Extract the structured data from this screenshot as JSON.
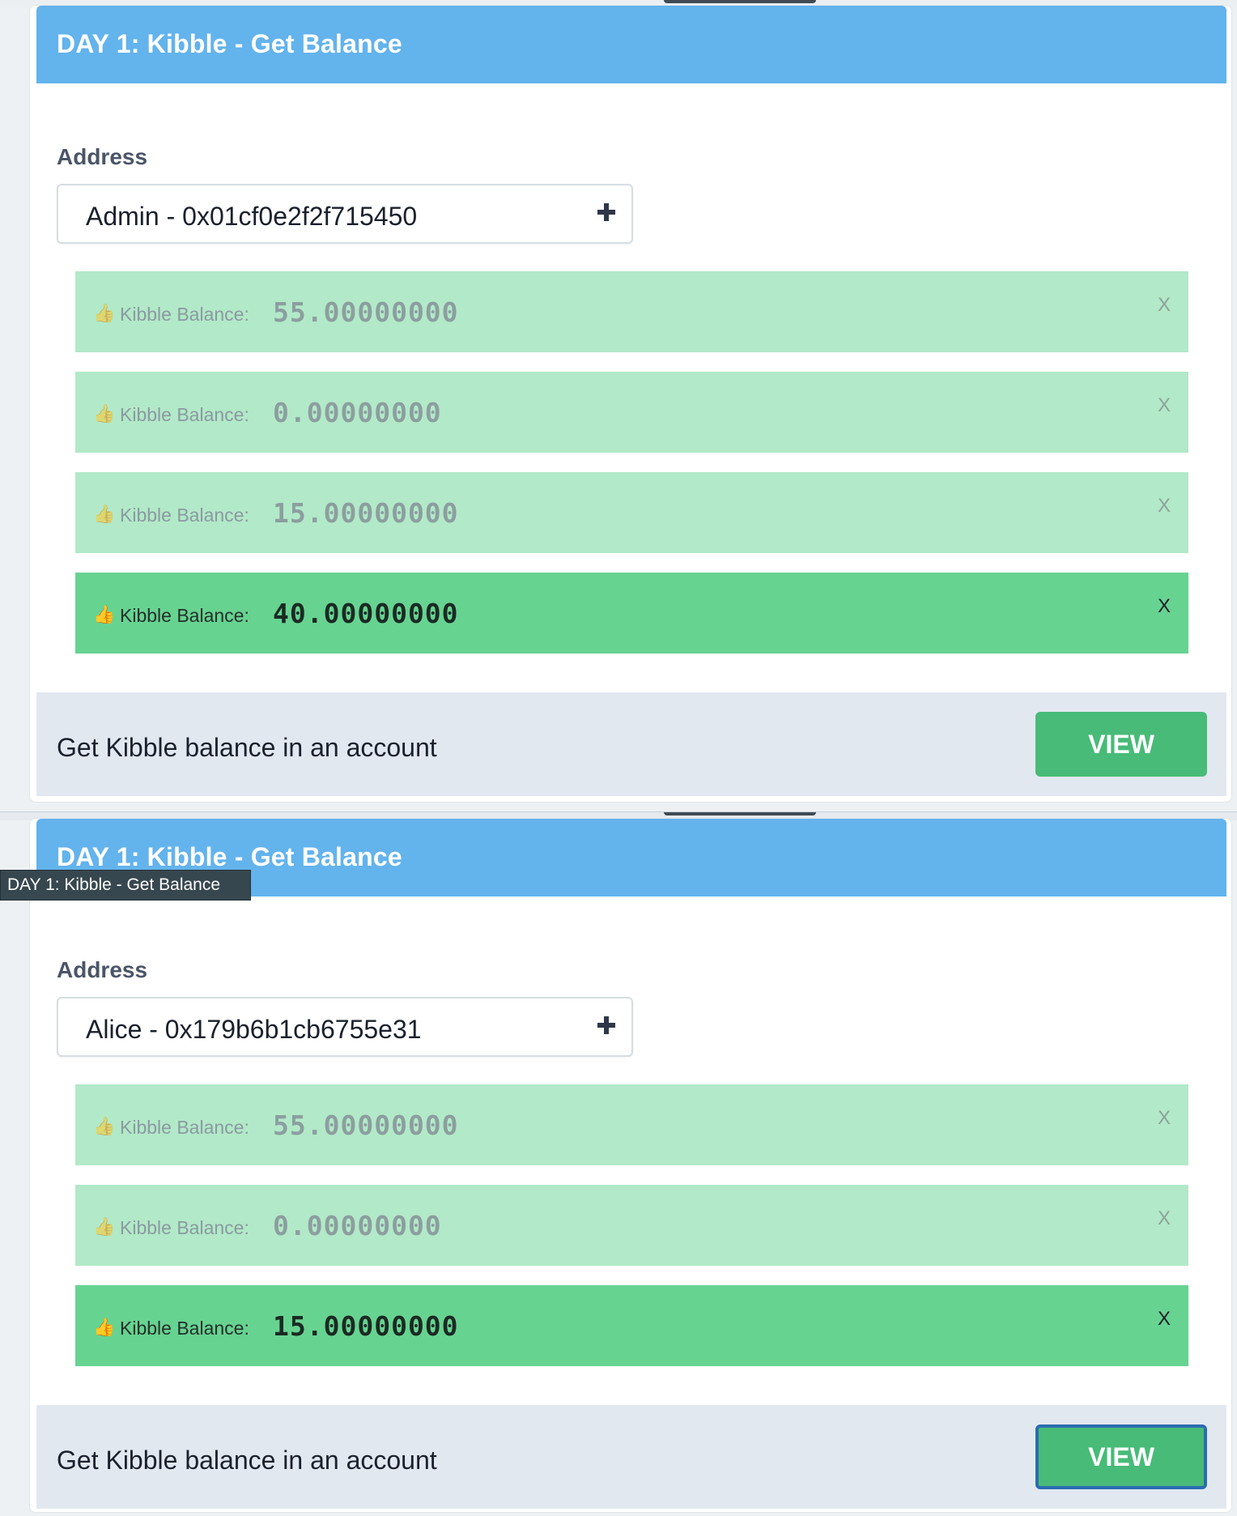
{
  "panels": [
    {
      "title": "DAY 1: Kibble - Get Balance",
      "address_label": "Address",
      "selected_address": "Admin - 0x01cf0e2f2f715450",
      "results": [
        {
          "label": "Kibble Balance:",
          "value": "55.00000000",
          "close": "X"
        },
        {
          "label": "Kibble Balance:",
          "value": "0.00000000",
          "close": "X"
        },
        {
          "label": "Kibble Balance:",
          "value": "15.00000000",
          "close": "X"
        },
        {
          "label": "Kibble Balance:",
          "value": "40.00000000",
          "close": "X"
        }
      ],
      "footer_text": "Get Kibble balance in an account",
      "view_label": "VIEW"
    },
    {
      "title": "DAY 1: Kibble - Get Balance",
      "address_label": "Address",
      "selected_address": "Alice - 0x179b6b1cb6755e31",
      "results": [
        {
          "label": "Kibble Balance:",
          "value": "55.00000000",
          "close": "X"
        },
        {
          "label": "Kibble Balance:",
          "value": "0.00000000",
          "close": "X"
        },
        {
          "label": "Kibble Balance:",
          "value": "15.00000000",
          "close": "X"
        }
      ],
      "footer_text": "Get Kibble balance in an account",
      "view_label": "VIEW"
    }
  ],
  "tooltip": "DAY 1: Kibble - Get Balance",
  "icons": {
    "result_icon": "thumbs-up-icon",
    "select_icon": "plus-icon"
  },
  "colors": {
    "header": "#63b3ed",
    "result_faded": "#b2e9c8",
    "result_active": "#67d391",
    "view_button": "#48bb78"
  }
}
